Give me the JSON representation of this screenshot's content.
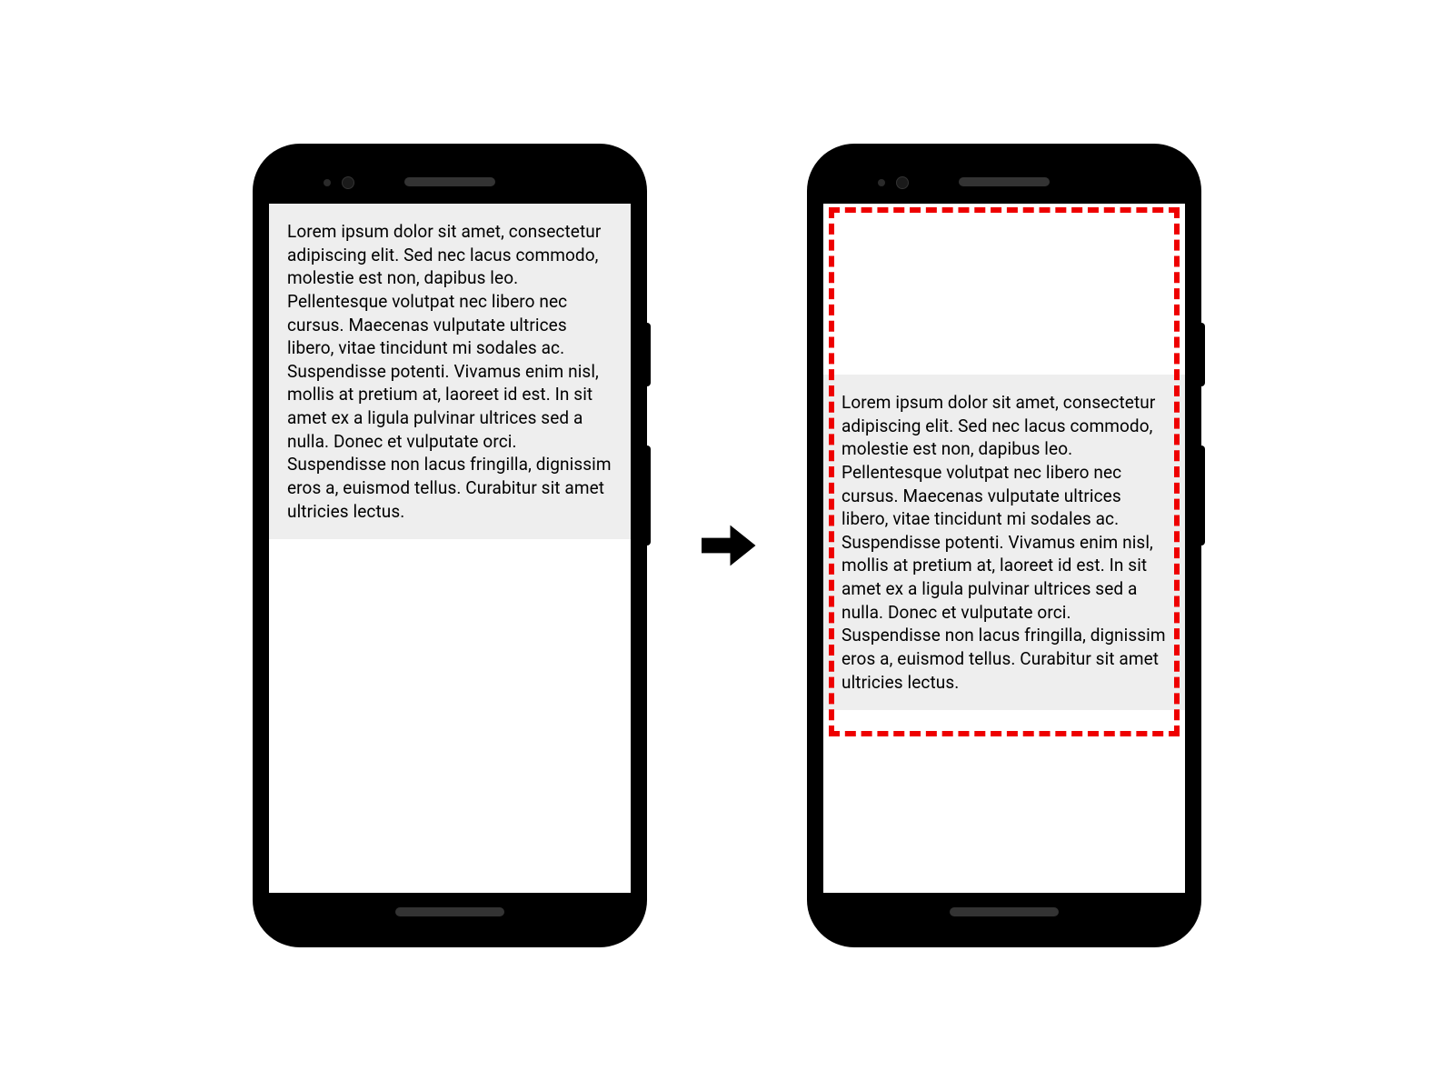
{
  "diagram": {
    "lorem_text": "Lorem ipsum dolor sit amet, consectetur adipiscing elit. Sed nec lacus commodo, molestie est non, dapibus leo. Pellentesque volutpat nec libero nec cursus. Maecenas vulputate ultrices libero, vitae tincidunt mi sodales ac. Suspendisse potenti. Vivamus enim nisl, mollis at pretium at, laoreet id est. In sit amet ex a ligula pulvinar ultrices sed a nulla. Donec et vulputate orci. Suspendisse non lacus fringilla, dignissim eros a, euismod tellus. Curabitur sit amet ultricies lectus.",
    "highlight_color": "#ee0000"
  }
}
